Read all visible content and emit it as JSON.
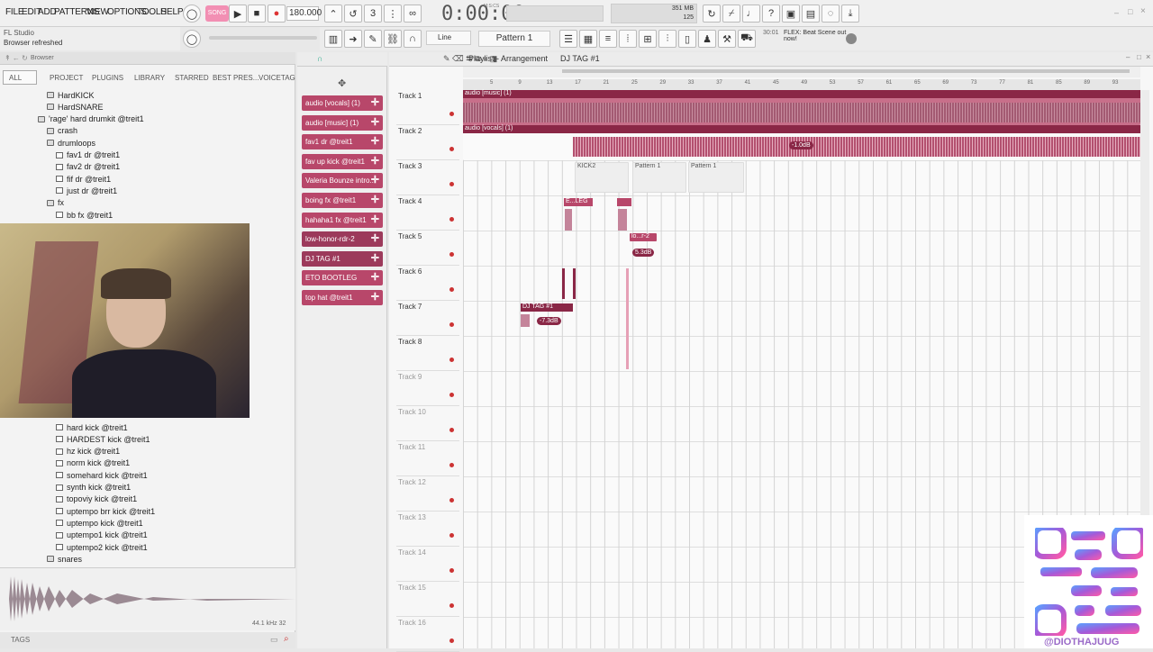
{
  "menu": [
    "FILE",
    "EDIT",
    "ADD",
    "PATTERNS",
    "VIEW",
    "OPTIONS",
    "TOOLS",
    "HELP"
  ],
  "transport": {
    "song_label": "SONG",
    "tempo": "180.000",
    "time": "0:00:00",
    "time_unit": "M:S:CS",
    "cpu": "351 MB",
    "voices": "125",
    "snap": "Line",
    "pattern": "Pattern 1",
    "hint_title": "FL Studio",
    "hint_text": "Browser refreshed",
    "news_time": "30:01",
    "news_text": "FLEX: Beat Scene out now!"
  },
  "browser": {
    "title": "Browser",
    "tabs": [
      "ALL",
      "PROJECT",
      "PLUGINS",
      "LIBRARY",
      "STARRED",
      "BEST PRES...",
      "VOICETAG"
    ],
    "tree_top": [
      {
        "label": "HardKICK",
        "kind": "folder"
      },
      {
        "label": "HardSNARE",
        "kind": "folder"
      },
      {
        "label": "'rage' hard drumkit @treit1",
        "kind": "folder"
      },
      {
        "label": "crash",
        "kind": "folder"
      },
      {
        "label": "drumloops",
        "kind": "folder"
      },
      {
        "label": "fav1 dr @treit1",
        "kind": "file"
      },
      {
        "label": "fav2 dr @treit1",
        "kind": "file"
      },
      {
        "label": "fif dr @treit1",
        "kind": "file"
      },
      {
        "label": "just dr @treit1",
        "kind": "file"
      },
      {
        "label": "fx",
        "kind": "folder"
      },
      {
        "label": "bb fx @treit1",
        "kind": "file"
      }
    ],
    "tree_bottom": [
      {
        "label": "hard kick @treit1",
        "kind": "file"
      },
      {
        "label": "HARDEST kick @treit1",
        "kind": "file"
      },
      {
        "label": "hz kick @treit1",
        "kind": "file"
      },
      {
        "label": "norm kick @treit1",
        "kind": "file"
      },
      {
        "label": "somehard kick @treit1",
        "kind": "file"
      },
      {
        "label": "synth kick @treit1",
        "kind": "file"
      },
      {
        "label": "topoviy kick @treit1",
        "kind": "file"
      },
      {
        "label": "uptempo brr kick @treit1",
        "kind": "file"
      },
      {
        "label": "uptempo kick @treit1",
        "kind": "file"
      },
      {
        "label": "uptempo1 kick @treit1",
        "kind": "file"
      },
      {
        "label": "uptempo2 kick @treit1",
        "kind": "file"
      },
      {
        "label": "snares",
        "kind": "folder"
      }
    ],
    "sample_info": "44.1 kHz 32",
    "tags_label": "TAGS"
  },
  "channels": [
    "audio [vocals] (1)",
    "audio [music] (1)",
    "fav1 dr @treit1",
    "fav up kick @treit1",
    "Valeria Bounze intro...",
    "boing fx @treit1",
    "hahaha1 fx @treit1",
    "low-honor-rdr-2",
    "DJ TAG #1",
    "ETO BOOTLEG",
    "top hat @treit1"
  ],
  "playlist": {
    "title": "Playlist - Arrangement",
    "pattern": "DJ TAG #1",
    "tracks": [
      "Track 1",
      "Track 2",
      "Track 3",
      "Track 4",
      "Track 5",
      "Track 6",
      "Track 7",
      "Track 8",
      "Track 9",
      "Track 10",
      "Track 11",
      "Track 12",
      "Track 13",
      "Track 14",
      "Track 15",
      "Track 16"
    ],
    "ruler": [
      "5",
      "9",
      "13",
      "17",
      "21",
      "25",
      "29",
      "33",
      "37",
      "41",
      "45",
      "49",
      "53",
      "57",
      "61",
      "65",
      "69",
      "73",
      "77",
      "81",
      "85",
      "89",
      "93"
    ],
    "clips": {
      "music": "audio [music] (1)",
      "vocals": "audio [vocals] (1)",
      "kick2": "KICK2",
      "pattern_a": "Pattern 1",
      "pattern_b": "Pattern 1",
      "eto": "E...LEG",
      "lo": "lo...r-2",
      "djtag": "DJ TAG #1"
    },
    "volumes": {
      "vocals": "-1.0dB",
      "lo": "5.3dB",
      "djtag": "-7.3dB"
    }
  },
  "social": {
    "handle": "@DIOTHAJUUG"
  },
  "colors": {
    "accent": "#b8476a",
    "clip_dark": "#8a2746",
    "waveform": "#a0566e"
  }
}
